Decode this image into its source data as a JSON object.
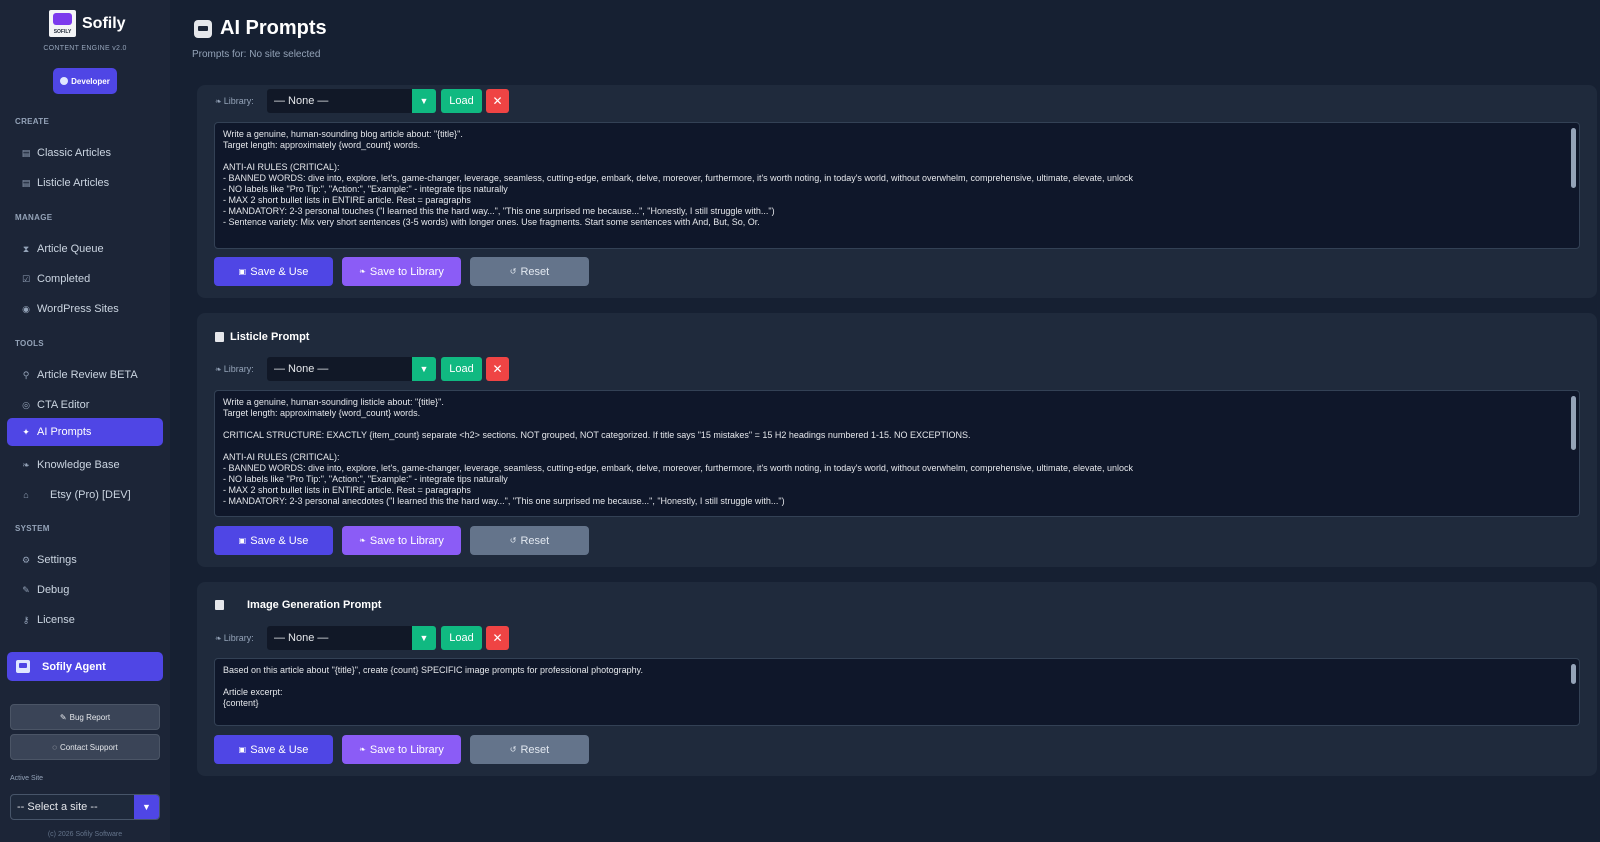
{
  "sidebar": {
    "brand": "Sofily",
    "logo_text": "SOFILY",
    "subtitle": "CONTENT ENGINE v2.0",
    "developer_label": "Developer",
    "sections": {
      "create": "CREATE",
      "manage": "MANAGE",
      "tools": "TOOLS",
      "system": "SYSTEM"
    },
    "items": {
      "classic": "Classic Articles",
      "listicle": "Listicle Articles",
      "queue": "Article Queue",
      "completed": "Completed",
      "wordpress": "WordPress Sites",
      "review": "Article Review BETA",
      "cta": "CTA Editor",
      "prompts": "AI Prompts",
      "kb": "Knowledge Base",
      "etsy": "Etsy (Pro)  [DEV]",
      "settings": "Settings",
      "debug": "Debug",
      "license": "License"
    },
    "agent_label": "Sofily Agent",
    "bug_report": "Bug Report",
    "contact_support": "Contact Support",
    "active_site_label": "Active Site",
    "active_site_value": "-- Select a site --",
    "copyright": "(c) 2026 Sofily Software"
  },
  "header": {
    "title": "AI Prompts",
    "subtitle": "Prompts for: No site selected"
  },
  "common": {
    "library_label": "Library:",
    "library_value": "— None —",
    "load": "Load",
    "delete": "✕",
    "save_use": "Save & Use",
    "save_library": "Save to Library",
    "reset": "Reset"
  },
  "cards": {
    "classic": {
      "lines": [
        "Write a genuine, human-sounding blog article about: \"{title}\".",
        "Target length: approximately {word_count} words.",
        "",
        "ANTI-AI RULES (CRITICAL):",
        "- BANNED WORDS: dive into, explore, let's, game-changer, leverage, seamless, cutting-edge, embark, delve, moreover, furthermore, it's worth noting, in today's world, without overwhelm, comprehensive, ultimate, elevate, unlock",
        "- NO labels like \"Pro Tip:\", \"Action:\", \"Example:\" - integrate tips naturally",
        "- MAX 2 short bullet lists in ENTIRE article. Rest = paragraphs",
        "- MANDATORY: 2-3 personal touches (\"I learned this the hard way...\", \"This one surprised me because...\", \"Honestly, I still struggle with...\")",
        "- Sentence variety: Mix very short sentences (3-5 words) with longer ones. Use fragments. Start some sentences with And, But, So, Or."
      ]
    },
    "listicle": {
      "title": "Listicle Prompt",
      "lines": [
        "Write a genuine, human-sounding listicle about: \"{title}\".",
        "Target length: approximately {word_count} words.",
        "",
        "CRITICAL STRUCTURE: EXACTLY {item_count} separate <h2> sections. NOT grouped, NOT categorized. If title says \"15 mistakes\" = 15 H2 headings numbered 1-15. NO EXCEPTIONS.",
        "",
        "ANTI-AI RULES (CRITICAL):",
        "- BANNED WORDS: dive into, explore, let's, game-changer, leverage, seamless, cutting-edge, embark, delve, moreover, furthermore, it's worth noting, in today's world, without overwhelm, comprehensive, ultimate, elevate, unlock",
        "- NO labels like \"Pro Tip:\", \"Action:\", \"Example:\" - integrate tips naturally",
        "- MAX 2 short bullet lists in ENTIRE article. Rest = paragraphs",
        "- MANDATORY: 2-3 personal anecdotes (\"I learned this the hard way...\", \"This one surprised me because...\", \"Honestly, I still struggle with...\")"
      ]
    },
    "image": {
      "title": "Image Generation Prompt",
      "lines": [
        "Based on this article about \"{title}\", create {count} SPECIFIC image prompts for professional photography.",
        "",
        "Article excerpt:",
        "{content}"
      ]
    }
  }
}
